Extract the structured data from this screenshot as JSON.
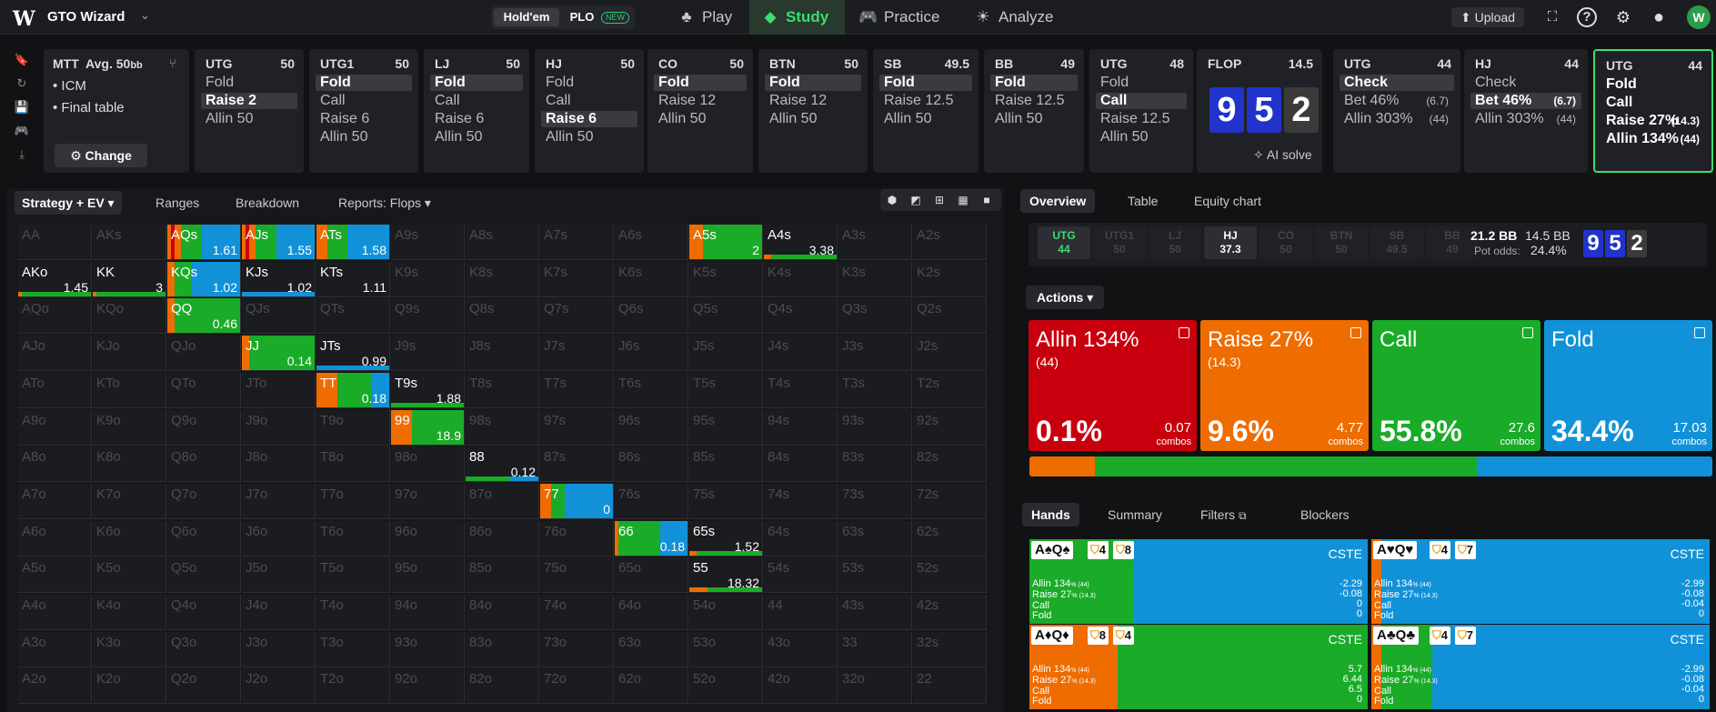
{
  "app": {
    "name": "GTO Wizard",
    "logo": "W",
    "game_types": [
      "Hold'em",
      "PLO"
    ],
    "new_badge": "NEW"
  },
  "nav": [
    {
      "label": "Play",
      "icon": "♣"
    },
    {
      "label": "Study",
      "icon": "◆"
    },
    {
      "label": "Practice",
      "icon": "🎮"
    },
    {
      "label": "Analyze",
      "icon": "☀"
    }
  ],
  "toolbar": {
    "upload": "⬆ Upload",
    "focus_icon": "⛶",
    "help_icon": "?",
    "settings_icon": "⚙",
    "profile_icon": "●",
    "avatar": "W"
  },
  "sidebar_icons": [
    "🔖",
    "↻",
    "💾",
    "🎮",
    "⤓"
  ],
  "mtt": {
    "title": "MTT",
    "avg": "Avg. 50",
    "avg_unit": "bb",
    "items": [
      "ICM",
      "Final table"
    ],
    "change_label": "⚙ Change"
  },
  "cards": [
    {
      "pos": "UTG",
      "stack": "50",
      "actions": [
        {
          "t": "Fold"
        },
        {
          "t": "Raise 2",
          "sel": true
        },
        {
          "t": "Allin 50"
        }
      ]
    },
    {
      "pos": "UTG1",
      "stack": "50",
      "actions": [
        {
          "t": "Fold",
          "sel": true
        },
        {
          "t": "Call"
        },
        {
          "t": "Raise 6"
        },
        {
          "t": "Allin 50"
        }
      ]
    },
    {
      "pos": "LJ",
      "stack": "50",
      "actions": [
        {
          "t": "Fold",
          "sel": true
        },
        {
          "t": "Call"
        },
        {
          "t": "Raise 6"
        },
        {
          "t": "Allin 50"
        }
      ]
    },
    {
      "pos": "HJ",
      "stack": "50",
      "actions": [
        {
          "t": "Fold"
        },
        {
          "t": "Call"
        },
        {
          "t": "Raise 6",
          "sel": true
        },
        {
          "t": "Allin 50"
        }
      ]
    },
    {
      "pos": "CO",
      "stack": "50",
      "actions": [
        {
          "t": "Fold",
          "sel": true
        },
        {
          "t": "Raise 12"
        },
        {
          "t": "Allin 50"
        }
      ]
    },
    {
      "pos": "BTN",
      "stack": "50",
      "actions": [
        {
          "t": "Fold",
          "sel": true
        },
        {
          "t": "Raise 12"
        },
        {
          "t": "Allin 50"
        }
      ]
    },
    {
      "pos": "SB",
      "stack": "49.5",
      "actions": [
        {
          "t": "Fold",
          "sel": true
        },
        {
          "t": "Raise 12.5"
        },
        {
          "t": "Allin 50"
        }
      ]
    },
    {
      "pos": "BB",
      "stack": "49",
      "actions": [
        {
          "t": "Fold",
          "sel": true
        },
        {
          "t": "Raise 12.5"
        },
        {
          "t": "Allin 50"
        }
      ]
    },
    {
      "pos": "UTG",
      "stack": "48",
      "actions": [
        {
          "t": "Fold"
        },
        {
          "t": "Call",
          "sel": true
        },
        {
          "t": "Raise 12.5"
        },
        {
          "t": "Allin 50"
        }
      ]
    }
  ],
  "flop": {
    "label": "FLOP",
    "pot": "14.5",
    "cards": [
      "9",
      "5",
      "2"
    ],
    "ai_solve": "AI solve"
  },
  "post_cards": [
    {
      "pos": "UTG",
      "stack": "44",
      "actions": [
        {
          "t": "Check",
          "sel": true
        },
        {
          "t": "Bet 46%",
          "s": "(6.7)"
        },
        {
          "t": "Allin 303%",
          "s": "(44)"
        }
      ]
    },
    {
      "pos": "HJ",
      "stack": "44",
      "actions": [
        {
          "t": "Check"
        },
        {
          "t": "Bet 46%",
          "s": "(6.7)",
          "sel": true
        },
        {
          "t": "Allin 303%",
          "s": "(44)"
        }
      ]
    },
    {
      "pos": "UTG",
      "stack": "44",
      "active": true,
      "actions": [
        {
          "t": "Fold"
        },
        {
          "t": "Call"
        },
        {
          "t": "Raise 27%",
          "s": "(14.3)"
        },
        {
          "t": "Allin 134%",
          "s": "(44)"
        }
      ]
    }
  ],
  "left_tabs": {
    "strategy": "Strategy + EV",
    "ranges": "Ranges",
    "breakdown": "Breakdown",
    "reports": "Reports: Flops"
  },
  "view_icons": [
    "⬢",
    "◩",
    "⊞",
    "▦",
    "■"
  ],
  "matrix": {
    "ranks": [
      "A",
      "K",
      "Q",
      "J",
      "T",
      "9",
      "8",
      "7",
      "6",
      "5",
      "4",
      "3",
      "2"
    ],
    "active": {
      "AQs": {
        "ev": "1.61",
        "mix": [
          0.05,
          0.1,
          0.3,
          0.55
        ]
      },
      "AJs": {
        "ev": "1.55",
        "mix": [
          0.05,
          0.1,
          0.3,
          0.55
        ]
      },
      "ATs": {
        "ev": "1.58",
        "mix": [
          0,
          0.1,
          0.3,
          0.6
        ]
      },
      "A5s": {
        "ev": "2",
        "mix": [
          0,
          0.15,
          0.85,
          0
        ]
      },
      "A4s": {
        "ev": "3.38",
        "mix": [
          0,
          0.1,
          0.9,
          0
        ],
        "thin": true
      },
      "AKo": {
        "ev": "1.45",
        "mix": [
          0,
          0.05,
          0.95,
          0
        ],
        "thin": true
      },
      "KK": {
        "ev": "3",
        "mix": [
          0,
          0.05,
          0.95,
          0
        ],
        "thin": true
      },
      "KQs": {
        "ev": "1.02",
        "mix": [
          0,
          0.05,
          0.25,
          0.7
        ]
      },
      "KJs": {
        "ev": "1.02",
        "mix": [
          0,
          0,
          0,
          1
        ],
        "thin": true
      },
      "KTs": {
        "ev": "1.11",
        "mix": [
          0,
          0,
          0,
          0
        ]
      },
      "QQ": {
        "ev": "0.46",
        "mix": [
          0,
          0.05,
          0.95,
          0
        ]
      },
      "JJ": {
        "ev": "0.14",
        "mix": [
          0,
          0.05,
          0.95,
          0
        ]
      },
      "JTs": {
        "ev": "0.99",
        "mix": [
          0,
          0,
          0,
          1
        ],
        "thin": true
      },
      "TT": {
        "ev": "0.18",
        "mix": [
          0,
          0.25,
          0.5,
          0.25
        ]
      },
      "T9s": {
        "ev": "1.88",
        "mix": [
          0,
          0,
          1,
          0
        ],
        "thin": true
      },
      "99": {
        "ev": "18.9",
        "mix": [
          0,
          0.25,
          0.75,
          0
        ]
      },
      "88": {
        "ev": "0.12",
        "mix": [
          0,
          0,
          0.6,
          0.4
        ],
        "thin": true
      },
      "77": {
        "ev": "0",
        "mix": [
          0,
          0.1,
          0.2,
          0.7
        ]
      },
      "66": {
        "ev": "0.18",
        "mix": [
          0,
          0,
          0.6,
          0.4
        ]
      },
      "65s": {
        "ev": "1.52",
        "mix": [
          0,
          0.1,
          0.9,
          0
        ],
        "thin": true
      },
      "55": {
        "ev": "18.32",
        "mix": [
          0,
          0.25,
          0.75,
          0
        ],
        "thin": true
      }
    }
  },
  "right_tabs": {
    "overview": "Overview",
    "table": "Table",
    "equity": "Equity chart"
  },
  "seats": [
    {
      "pos": "UTG",
      "stack": "44",
      "state": "grn"
    },
    {
      "pos": "UTG1",
      "stack": "50"
    },
    {
      "pos": "LJ",
      "stack": "50"
    },
    {
      "pos": "HJ",
      "stack": "37.3",
      "state": "hl"
    },
    {
      "pos": "CO",
      "stack": "50"
    },
    {
      "pos": "BTN",
      "stack": "50"
    },
    {
      "pos": "SB",
      "stack": "49.5"
    },
    {
      "pos": "BB",
      "stack": "49"
    }
  ],
  "pot": {
    "main": "21.2 BB",
    "side": "14.5 BB",
    "odds_label": "Pot odds:",
    "odds": "24.4%",
    "board": [
      "9",
      "5",
      "2"
    ]
  },
  "actions_label": "Actions",
  "actions": [
    {
      "name": "Allin 134%",
      "size": "(44)",
      "pct": "0.1%",
      "combos": "0.07",
      "color": "#c8000e"
    },
    {
      "name": "Raise 27%",
      "size": "(14.3)",
      "pct": "9.6%",
      "combos": "4.77",
      "color": "#ef6c00"
    },
    {
      "name": "Call",
      "size": "",
      "pct": "55.8%",
      "combos": "27.6",
      "color": "#1aab28"
    },
    {
      "name": "Fold",
      "size": "",
      "pct": "34.4%",
      "combos": "17.03",
      "color": "#1192d8"
    }
  ],
  "combos_label": "combos",
  "freq": [
    0.1,
    9.6,
    55.8,
    34.4
  ],
  "bottom_tabs": {
    "hands": "Hands",
    "summary": "Summary",
    "filters": "Filters",
    "blockers": "Blockers"
  },
  "hands": [
    {
      "cards": "A♠Q♠",
      "b1": "4",
      "b2": "8",
      "cste": "CSTE",
      "mix": [
        0,
        0,
        0.31,
        0.69
      ],
      "vals": [
        "-2.29",
        "-0.08",
        "0",
        "0"
      ]
    },
    {
      "cards": "A♥Q♥",
      "b1": "4",
      "b2": "7",
      "cste": "CSTE",
      "mix": [
        0,
        0.03,
        0,
        0.97
      ],
      "vals": [
        "-2.99",
        "-0.08",
        "-0.04",
        "0"
      ]
    },
    {
      "cards": "A♦Q♦",
      "b1": "8",
      "b2": "4",
      "cste": "CSTE",
      "mix": [
        0,
        0.26,
        0.74,
        0
      ],
      "vals": [
        "5.7",
        "6.44",
        "6.5",
        "0"
      ]
    },
    {
      "cards": "A♣Q♣",
      "b1": "4",
      "b2": "7",
      "cste": "CSTE",
      "mix": [
        0,
        0.03,
        0.15,
        0.82
      ],
      "vals": [
        "-2.99",
        "-0.08",
        "-0.04",
        "0"
      ]
    }
  ],
  "hand_labels": {
    "allin": "Allin 134",
    "allin_sub": "% (44)",
    "raise": "Raise 27",
    "raise_sub": "% (14.3)",
    "call": "Call",
    "fold": "Fold"
  },
  "colors": {
    "allin": "#c8000e",
    "raise": "#ef6c00",
    "call": "#1aab28",
    "fold": "#1192d8",
    "accent": "#3ddc6f"
  }
}
